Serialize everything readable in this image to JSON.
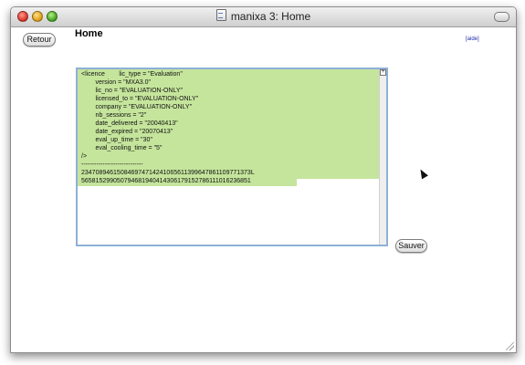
{
  "window": {
    "title": "manixa 3: Home"
  },
  "toolbar": {
    "back_label": "Retour",
    "save_label": "Sauver",
    "help_label": "[aide]"
  },
  "page": {
    "title": "Home"
  },
  "editor": {
    "content": "<licence        lic_type = \"Evaluation\"\n        version = \"MXA3.0\"\n        lic_no = \"EVALUATION-ONLY\"\n        licensed_to = \"EVALUATION-ONLY\"\n        company = \"EVALUATION-ONLY\"\n        nb_sessions = \"2\"\n        date_delivered = \"20040413\"\n        date_expired = \"20070413\"\n        eval_up_time = \"30\"\n        eval_cooling_time = \"5\"\n/>\n-----------------------------\n234708946150846974714241065611399647861109771373L\n565815299050794681940414306179152786111016236851"
  },
  "icons": {
    "document": "document-icon",
    "toolbar_toggle": "toolbar-toggle-icon",
    "resize": "resize-grip-icon",
    "expand": "expand-icon",
    "pointer": "mouse-pointer-icon"
  },
  "colors": {
    "selection": "#c5e59c",
    "focus_ring": "#8fb0d8",
    "link": "#1a2aa8"
  }
}
